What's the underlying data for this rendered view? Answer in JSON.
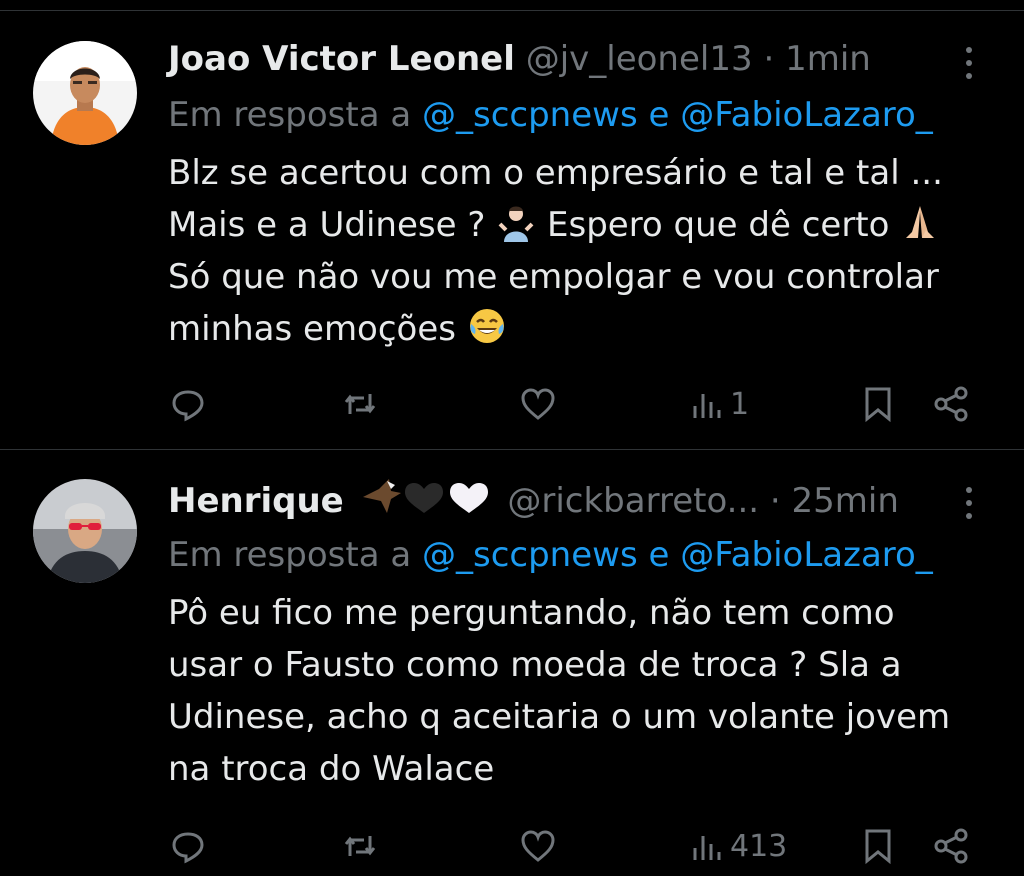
{
  "tweets": [
    {
      "name": "Joao Victor Leonel",
      "handle": "@jv_leonel13",
      "separator": "·",
      "time": "1min",
      "reply_prefix": "Em resposta a",
      "mentions": [
        "@_sccpnews",
        "@FabioLazaro_"
      ],
      "reply_joiner": "e",
      "body_lines": [
        "Blz se acertou com o empresário e tal e tal ...",
        "Mais e a Udinese ?",
        "Espero que dê certo",
        "Só que não vou me empolgar e vou controlar",
        "minhas emoções"
      ],
      "actions": {
        "reply_count": "",
        "retweet_count": "",
        "like_count": "",
        "views_count": "1"
      },
      "icons": [
        "reply-icon",
        "retweet-icon",
        "like-icon",
        "views-icon",
        "bookmark-icon",
        "share-icon"
      ]
    },
    {
      "name": "Henrique",
      "handle": "@rickbarreto...",
      "separator": "·",
      "time": "25min",
      "reply_prefix": "Em resposta a",
      "mentions": [
        "@_sccpnews",
        "@FabioLazaro_"
      ],
      "reply_joiner": "e",
      "body_lines": [
        "Pô eu fico me perguntando, não tem como",
        "usar o Fausto como moeda de troca ? Sla a",
        "Udinese, acho q aceitaria o um volante jovem",
        "na troca do Walace"
      ],
      "actions": {
        "reply_count": "",
        "retweet_count": "",
        "like_count": "",
        "views_count": "413"
      },
      "icons": [
        "reply-icon",
        "retweet-icon",
        "like-icon",
        "views-icon",
        "bookmark-icon",
        "share-icon"
      ]
    }
  ],
  "colors": {
    "background": "#000000",
    "text_primary": "#e7e9ea",
    "text_secondary": "#71767b",
    "link": "#1d9bf0",
    "divider": "#2f3336"
  }
}
